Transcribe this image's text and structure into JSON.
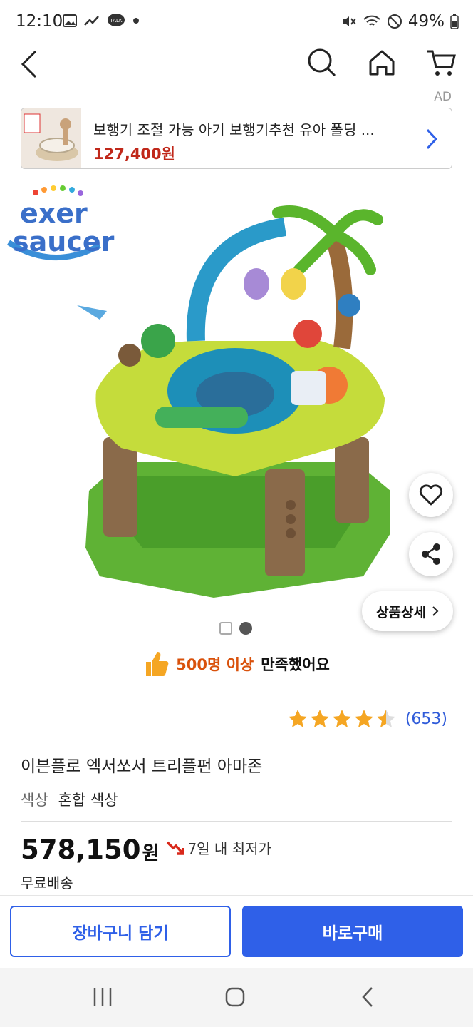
{
  "status_bar": {
    "time": "12:10",
    "battery": "49%"
  },
  "ad": {
    "label": "AD",
    "title": "보행기 조절 가능 아기 보행기추천 유아 폴딩 ...",
    "price": "127,400원"
  },
  "product": {
    "brand_logo": [
      "exer",
      "saucer"
    ],
    "satisfaction_highlight": "500명 이상",
    "satisfaction_rest": "만족했어요",
    "rating_value": 4.5,
    "review_count": "(653)",
    "name": "이븐플로 엑서쏘서 트리플펀 아마존",
    "option_key": "색상",
    "option_value": "혼합 색상",
    "price": "578,150",
    "price_unit": "원",
    "lowest_badge": "7일 내 최저가",
    "shipping": "무료배송",
    "detail_button": "상품상세"
  },
  "actions": {
    "cart": "장바구니 담기",
    "buy": "바로구매"
  },
  "colors": {
    "accent": "#2f60e8",
    "price_red": "#c0281a",
    "highlight_orange": "#d9510b",
    "star": "#f5a623"
  }
}
